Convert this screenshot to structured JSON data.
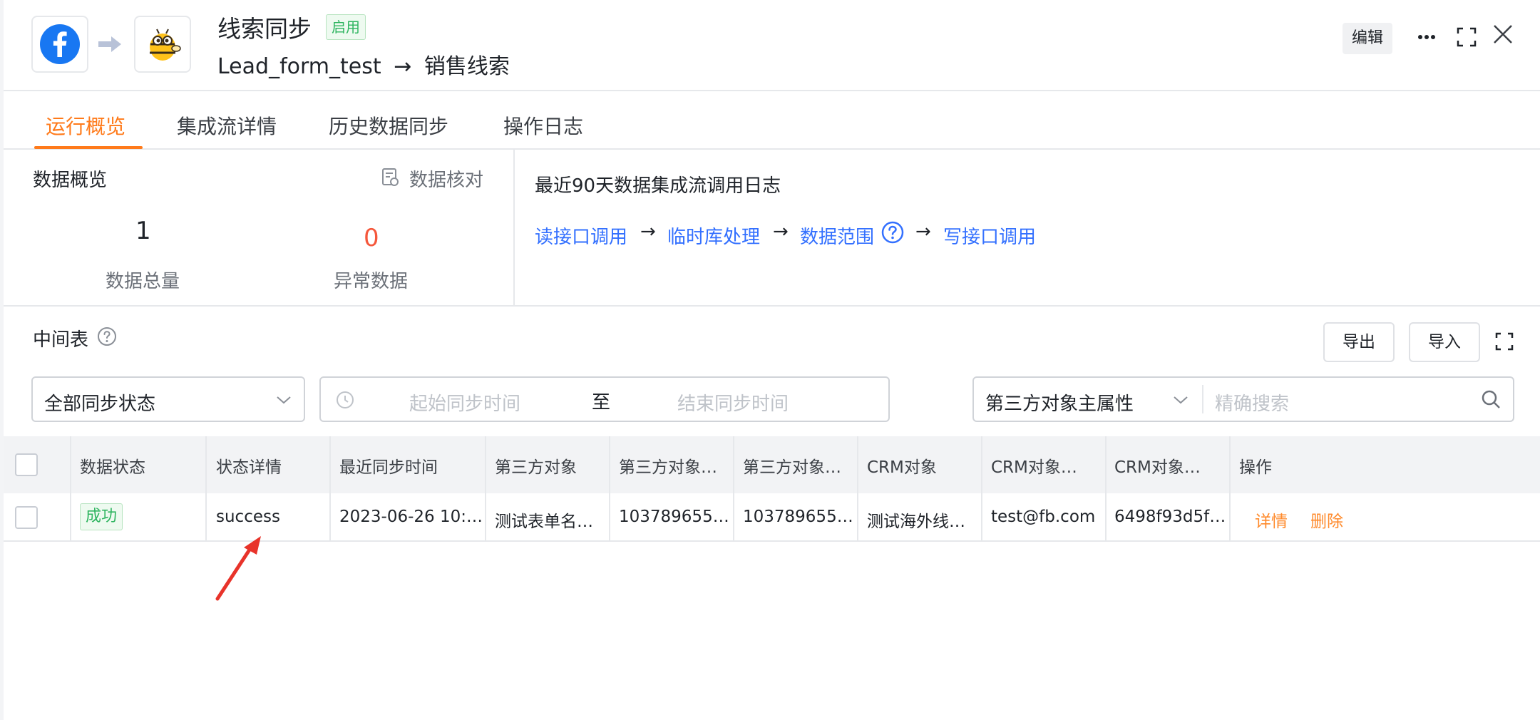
{
  "header": {
    "title": "线索同步",
    "status_badge": "启用",
    "source_object": "Lead_form_test",
    "flow_arrow": "→",
    "target_object": "销售线索",
    "edit_label": "编辑"
  },
  "tabs": [
    {
      "label": "运行概览",
      "active": true
    },
    {
      "label": "集成流详情",
      "active": false
    },
    {
      "label": "历史数据同步",
      "active": false
    },
    {
      "label": "操作日志",
      "active": false
    }
  ],
  "overview": {
    "title": "数据概览",
    "reconcile_label": "数据核对",
    "total_value": "1",
    "total_label": "数据总量",
    "error_value": "0",
    "error_label": "异常数据"
  },
  "call_log": {
    "title": "最近90天数据集成流调用日志",
    "steps": [
      "读接口调用",
      "临时库处理",
      "数据范围",
      "写接口调用"
    ],
    "arrow": "→"
  },
  "intermediate": {
    "title": "中间表",
    "export_label": "导出",
    "import_label": "导入",
    "status_filter": "全部同步状态",
    "date_start_placeholder": "起始同步时间",
    "date_to": "至",
    "date_end_placeholder": "结束同步时间",
    "search_field": "第三方对象主属性",
    "search_placeholder": "精确搜索"
  },
  "table": {
    "columns": [
      "数据状态",
      "状态详情",
      "最近同步时间",
      "第三方对象",
      "第三方对象…",
      "第三方对象…",
      "CRM对象",
      "CRM对象…",
      "CRM对象…",
      "操作"
    ],
    "rows": [
      {
        "status": "成功",
        "detail": "success",
        "sync_time": "2023-06-26 10:…",
        "third_obj": "测试表单名…",
        "third_obj2": "103789655…",
        "third_obj3": "103789655…",
        "crm_obj": "测试海外线…",
        "crm_obj2": "test@fb.com",
        "crm_obj3": "6498f93d5f…",
        "op_detail": "详情",
        "op_delete": "删除"
      }
    ]
  },
  "colors": {
    "accent": "#ff7a1a",
    "link": "#3370ff",
    "success": "#2fb560",
    "error": "#f5573b",
    "annotation": "#e8332a"
  }
}
